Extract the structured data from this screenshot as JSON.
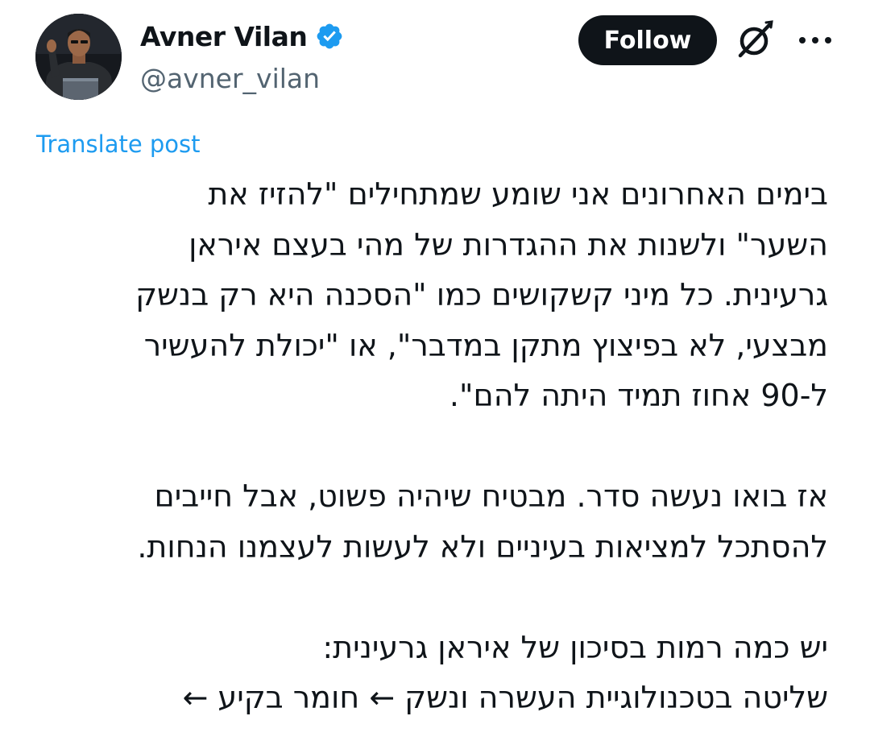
{
  "author": {
    "display_name": "Avner Vilan",
    "handle": "@avner_vilan",
    "verified_icon": "verified-badge-icon",
    "avatar": "avatar"
  },
  "actions": {
    "follow_label": "Follow",
    "grok_icon": "grok-icon",
    "more_icon": "more-icon"
  },
  "translate_label": "Translate post",
  "post": {
    "paragraph1": [
      "בימים האחרונים אני שומע שמתחילים \"להזיז את",
      "השער\" ולשנות את ההגדרות של מהי בעצם איראן",
      "גרעינית. כל מיני קשקושים כמו \"הסכנה היא רק בנשק",
      "מבצעי, לא בפיצוץ מתקן במדבר\", או \"יכולת להעשיר",
      "ל-90 אחוז תמיד היתה להם\"."
    ],
    "paragraph2": [
      "אז בואו נעשה סדר. מבטיח שיהיה פשוט, אבל חייבים",
      "להסתכל למציאות בעיניים ולא לעשות לעצמנו הנחות."
    ],
    "paragraph3": [
      "יש כמה רמות בסיכון של איראן גרעינית:",
      "שליטה בטכנולוגיית העשרה ונשק ← חומר בקיע ←"
    ]
  },
  "colors": {
    "accent": "#1d9bf0",
    "text": "#0f1419",
    "secondary": "#536471",
    "follow_bg": "#0f1419"
  }
}
